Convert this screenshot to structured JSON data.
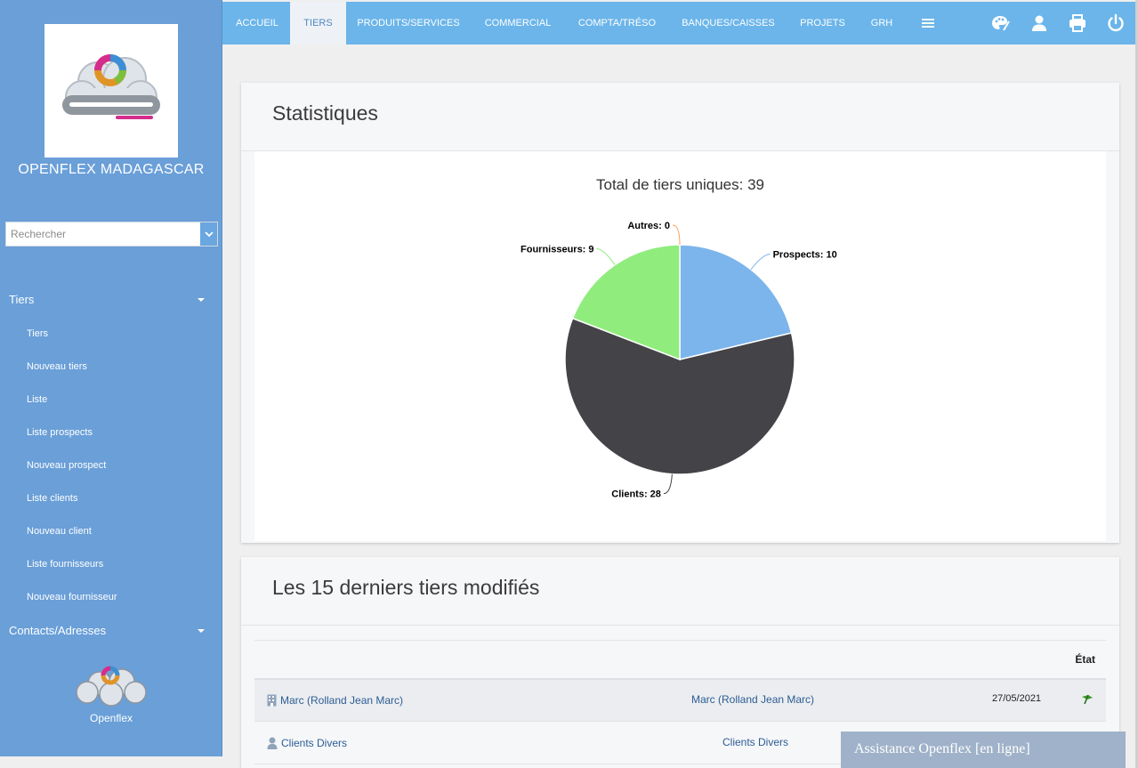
{
  "sidebar": {
    "company_name": "OPENFLEX MADAGASCAR",
    "search_placeholder": "Rechercher",
    "sections": [
      {
        "label": "Tiers"
      },
      {
        "label": "Contacts/Adresses"
      }
    ],
    "items": [
      {
        "label": "Tiers"
      },
      {
        "label": "Nouveau tiers"
      },
      {
        "label": "Liste"
      },
      {
        "label": "Liste prospects"
      },
      {
        "label": "Nouveau prospect"
      },
      {
        "label": "Liste clients"
      },
      {
        "label": "Nouveau client"
      },
      {
        "label": "Liste fournisseurs"
      },
      {
        "label": "Nouveau fournisseur"
      }
    ],
    "bottom_label": "Openflex"
  },
  "topnav": {
    "items": [
      {
        "label": "ACCUEIL"
      },
      {
        "label": "TIERS"
      },
      {
        "label": "PRODUITS/SERVICES"
      },
      {
        "label": "COMMERCIAL"
      },
      {
        "label": "COMPTA/TRÉSO"
      },
      {
        "label": "BANQUES/CAISSES"
      },
      {
        "label": "PROJETS"
      },
      {
        "label": "GRH"
      }
    ],
    "active": "TIERS",
    "icons": [
      "menu-icon",
      "palette-icon",
      "user-icon",
      "printer-icon",
      "power-icon"
    ]
  },
  "stats": {
    "title": "Statistiques",
    "chart_title": "Total de tiers uniques: 39"
  },
  "chart_data": {
    "type": "pie",
    "title": "Total de tiers uniques: 39",
    "slices": [
      {
        "name": "Prospects",
        "value": 10,
        "label": "Prospects: 10",
        "color": "#7cb5ec"
      },
      {
        "name": "Clients",
        "value": 28,
        "label": "Clients: 28",
        "color": "#434348"
      },
      {
        "name": "Fournisseurs",
        "value": 9,
        "label": "Fournisseurs: 9",
        "color": "#90ed7d"
      },
      {
        "name": "Autres",
        "value": 0,
        "label": "Autres: 0",
        "color": "#f7a35c"
      }
    ]
  },
  "recent": {
    "title": "Les 15 derniers tiers modifiés",
    "header_etat": "État",
    "rows": [
      {
        "name": "Marc (Rolland Jean Marc)",
        "mid": "Marc (Rolland Jean Marc)",
        "date": "27/05/2021",
        "icon": "building-icon"
      },
      {
        "name": "Clients Divers",
        "mid": "Clients Divers",
        "date": "",
        "icon": "person-icon"
      }
    ]
  },
  "chat": {
    "label": "Assistance Openflex [en ligne]"
  },
  "colors": {
    "sidebar": "#6a9fd8",
    "topnav": "#6bb5ea",
    "link": "#2c5d95"
  }
}
